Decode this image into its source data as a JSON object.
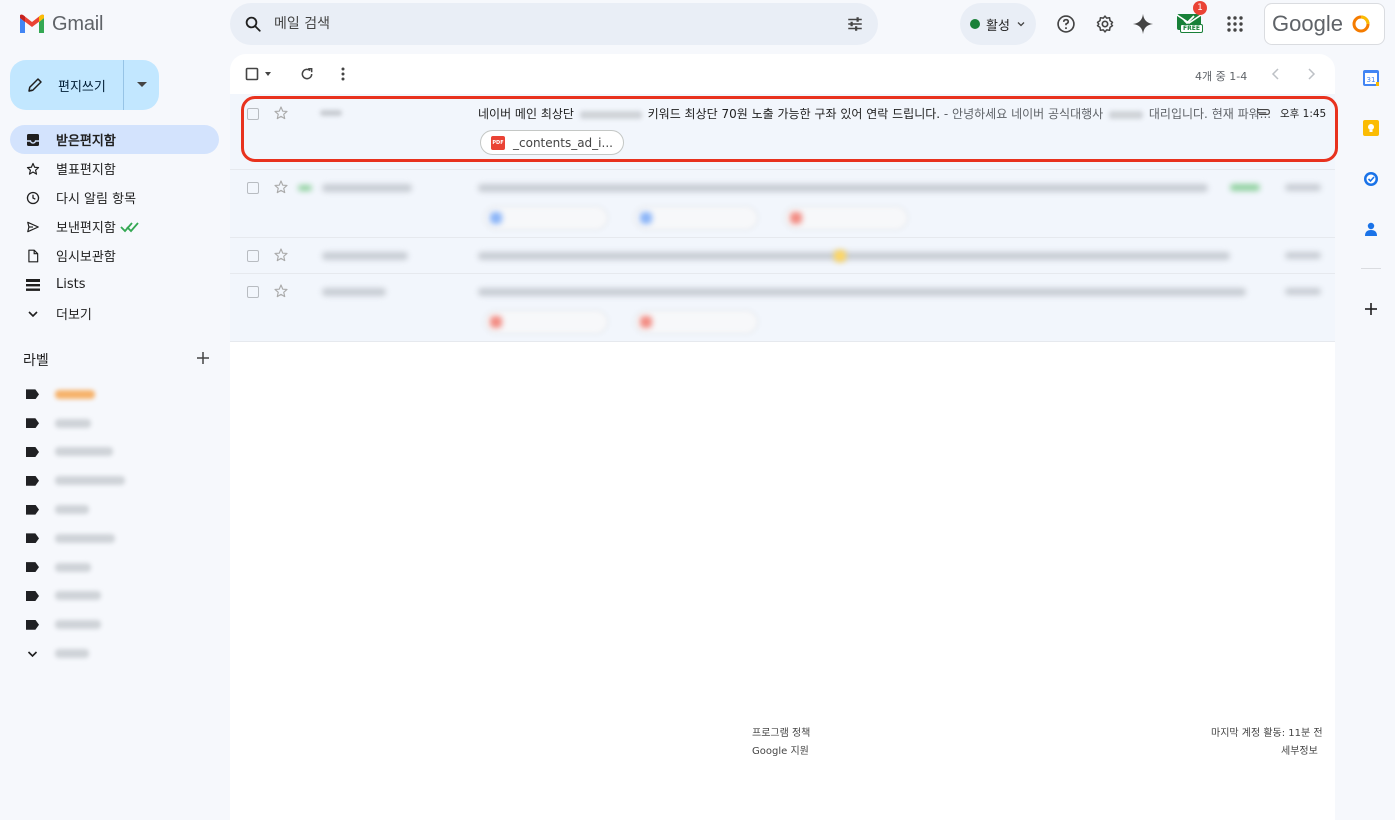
{
  "app": {
    "name": "Gmail"
  },
  "search": {
    "placeholder": "메일 검색"
  },
  "status": {
    "label": "활성"
  },
  "notification": {
    "count": "1",
    "tag": "FREE"
  },
  "account": {
    "brand": "Google"
  },
  "compose": {
    "label": "편지쓰기"
  },
  "nav": {
    "items": [
      {
        "label": "받은편지함",
        "icon": "inbox-icon"
      },
      {
        "label": "별표편지함",
        "icon": "star-icon"
      },
      {
        "label": "다시 알림 항목",
        "icon": "clock-icon"
      },
      {
        "label": "보낸편지함",
        "icon": "send-icon"
      },
      {
        "label": "임시보관함",
        "icon": "draft-icon"
      },
      {
        "label": "Lists",
        "icon": "lists-icon"
      },
      {
        "label": "더보기",
        "icon": "chevron-down-icon"
      }
    ]
  },
  "labels": {
    "title": "라벨"
  },
  "toolbar": {
    "pager": "4개 중 1-4"
  },
  "emails": [
    {
      "subject_part1": "네이버 메인 최상단",
      "subject_part2": "키워드 최상단 70원 노출 가능한 구좌 있어 연락 드립니다.",
      "snippet_part1": " - 안녕하세요 네이버 공식대행사",
      "snippet_part2": "대리입니다. 현재 파워...",
      "time": "오후 1:45",
      "attachment": "_contents_ad_i...",
      "attachment_type": "PDF"
    }
  ],
  "footer": {
    "policy": "프로그램 정책",
    "support": "Google 지원",
    "activity": "마지막 계정 활동: 11분 전",
    "details": "세부정보"
  },
  "colors": {
    "accent": "#c2e7ff",
    "active_nav": "#d3e3fd",
    "highlight": "#e8321e",
    "status": "#188038"
  }
}
